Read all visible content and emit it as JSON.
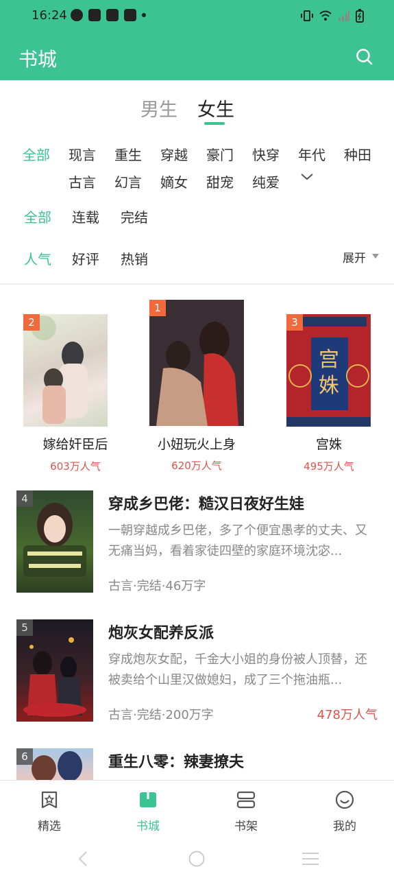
{
  "status_bar": {
    "time": "16:24"
  },
  "header": {
    "title": "书城"
  },
  "gender_tabs": {
    "male": "男生",
    "female": "女生"
  },
  "categories": {
    "row1": [
      "全部",
      "现言",
      "重生",
      "穿越",
      "豪门",
      "快穿",
      "年代",
      "种田"
    ],
    "row2": [
      "古言",
      "幻言",
      "嫡女",
      "甜宠",
      "纯爱"
    ]
  },
  "status_filter": [
    "全部",
    "连载",
    "完结"
  ],
  "sort_filter": [
    "人气",
    "好评",
    "热销"
  ],
  "expand_label": "展开",
  "top3": [
    {
      "rank": "2",
      "title": "嫁给奸臣后",
      "popularity": "603万人气"
    },
    {
      "rank": "1",
      "title": "小妞玩火上身",
      "popularity": "620万人气"
    },
    {
      "rank": "3",
      "title": "宫姝",
      "popularity": "495万人气",
      "cover_text": "宫姝"
    }
  ],
  "list": [
    {
      "rank": "4",
      "title": "穿成乡巴佬：糙汉日夜好生娃",
      "desc": "一朝穿越成乡巴佬，多了个便宜愚孝的丈夫、又无痛当妈，看着家徒四壁的家庭环境沈宓...",
      "meta": "古言·完结·46万字",
      "popularity": ""
    },
    {
      "rank": "5",
      "title": "炮灰女配养反派",
      "desc": "穿成炮灰女配，千金大小姐的身份被人顶替，还被卖给个山里汉做媳妇，成了三个拖油瓶...",
      "meta": "古言·完结·200万字",
      "popularity": "478万人气"
    },
    {
      "rank": "6",
      "title": "重生八零：辣妻撩夫"
    }
  ],
  "tabbar": [
    "精选",
    "书城",
    "书架",
    "我的"
  ],
  "colors": {
    "accent": "#3cc394",
    "popularity": "#e0524b"
  }
}
